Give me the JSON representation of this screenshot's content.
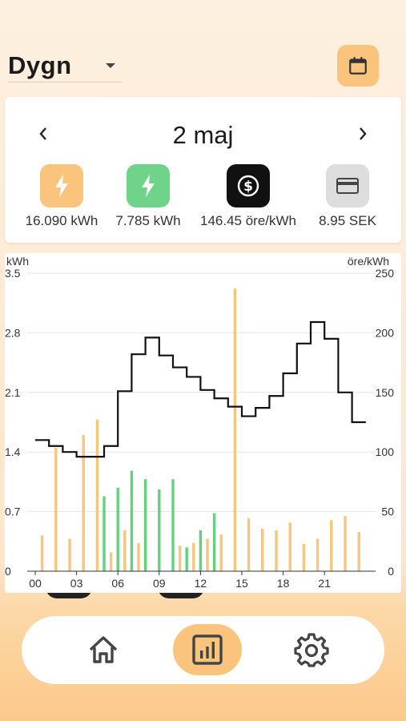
{
  "header": {
    "period_value": "Dygn",
    "calendar_icon": "calendar-icon"
  },
  "summary": {
    "date": "2 maj",
    "prev_icon": "chevron-left-icon",
    "next_icon": "chevron-right-icon",
    "stats": [
      {
        "value": "16.090 kWh",
        "icon": "bolt-icon",
        "color": "#fbc47c"
      },
      {
        "value": "7.785 kWh",
        "icon": "bolt-icon",
        "color": "#6fd48a"
      },
      {
        "value": "146.45 öre/kWh",
        "icon": "dollar-icon",
        "color": "#111111"
      },
      {
        "value": "8.95 SEK",
        "icon": "card-icon",
        "color": "#dddddd"
      }
    ]
  },
  "chart_data": {
    "type": "bar",
    "left_unit": "kWh",
    "right_unit": "öre/kWh",
    "y_left_ticks": [
      "0",
      "0.7",
      "1.4",
      "2.1",
      "2.8",
      "3.5"
    ],
    "y_right_ticks": [
      "0",
      "50",
      "100",
      "150",
      "200",
      "250"
    ],
    "x_ticks": [
      "00",
      "03",
      "06",
      "09",
      "12",
      "15",
      "18",
      "21"
    ],
    "ylim": [
      0,
      3.5
    ],
    "y2lim": [
      0,
      250
    ],
    "grid": true,
    "series": [
      {
        "color": "#f8c57d",
        "x": [
          0.5,
          1.5,
          2.5,
          3.5,
          4.5,
          5.5,
          6.5,
          7.5,
          10.5,
          11.5,
          12.5,
          13.5,
          14.5,
          15.5,
          16.5,
          17.5,
          18.5,
          19.5,
          20.5,
          21.5,
          22.5,
          23.5
        ],
        "values": [
          0.42,
          1.45,
          0.38,
          1.6,
          1.78,
          0.22,
          0.48,
          0.33,
          0.3,
          0.33,
          0.38,
          0.43,
          3.32,
          0.62,
          0.5,
          0.48,
          0.57,
          0.32,
          0.38,
          0.6,
          0.65,
          0.46
        ]
      },
      {
        "color": "#63d17e",
        "x": [
          5.0,
          6.0,
          7.0,
          8.0,
          9.0,
          10.0,
          11.0,
          12.0,
          13.0
        ],
        "values": [
          0.88,
          0.98,
          1.18,
          1.08,
          0.96,
          1.08,
          0.28,
          0.48,
          0.68
        ]
      },
      {
        "color": "#000000",
        "type": "step",
        "x": [
          0,
          1,
          2,
          3,
          4,
          5,
          6,
          7,
          8,
          9,
          10,
          11,
          12,
          13,
          14,
          15,
          16,
          17,
          18,
          19,
          20,
          21,
          22,
          23
        ],
        "values": [
          110,
          105,
          100,
          96,
          96,
          105,
          151,
          182,
          196,
          181,
          171,
          163,
          152,
          145,
          138,
          130,
          137,
          147,
          166,
          191,
          209,
          195,
          150,
          125
        ]
      }
    ]
  },
  "nav": {
    "home_icon": "home-icon",
    "stats_icon": "bar-chart-icon",
    "settings_icon": "gear-icon"
  }
}
